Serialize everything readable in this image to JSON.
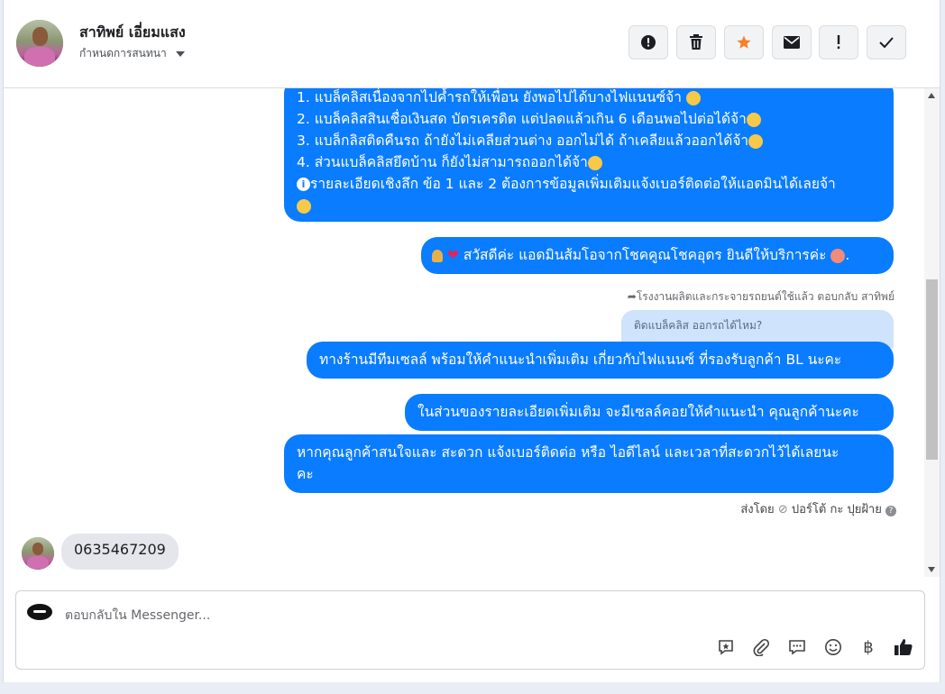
{
  "header": {
    "contact_name": "สาทิพย์ เอี่ยมแสง",
    "assign_label": "กำหนดการสนทนา",
    "buttons": [
      {
        "name": "spam-button",
        "icon": "alert-circle-icon"
      },
      {
        "name": "delete-button",
        "icon": "trash-icon"
      },
      {
        "name": "star-button",
        "icon": "star-icon"
      },
      {
        "name": "mark-unread-button",
        "icon": "envelope-icon"
      },
      {
        "name": "follow-up-button",
        "icon": "exclamation-icon"
      },
      {
        "name": "done-button",
        "icon": "check-icon"
      }
    ]
  },
  "messages": {
    "list_msg": {
      "line1": "1. แบล็คลิสเนื่องจากไปค้ำรถให้เพื่อน ยังพอไปได้บางไฟแนนซ์จ้า",
      "line2": "2. แบล็คลิสสินเชื่อเงินสด บัตรเครดิต แต่ปลดแล้วเกิน 6 เดือนพอไปต่อได้จ้า",
      "line3": "3. แบล็กลิสติดคืนรถ ถ้ายังไม่เคลียส่วนต่าง ออกไม่ได้ ถ้าเคลียแล้วออกได้จ้า",
      "line4": "4. ส่วนแบล็คลิสยึดบ้าน ก็ยังไม่สามารถออกได้จ้า",
      "line5": "รายละเอียดเชิงลึก ข้อ 1 และ 2 ต้องการข้อมูลเพิ่มเติมแจ้งเบอร์ติดต่อให้แอดมินได้เลยจ้า"
    },
    "greeting": "สวัสดีค่ะ แอดมินส้มโอจากโชคคูณโชคอุดร ยินดีให้บริการค่ะ",
    "greeting_suffix": ".",
    "reply_note": "โรงงานผลิตและกระจายรถยนต์ใช้แล้ว ตอบกลับ สาทิพย์",
    "quoted_text": "ติดแบล็คลิส ออกรถได้ไหม?",
    "msg_team": "ทางร้านมีทีมเซลล์ พร้อมให้คำแนะนำเพิ่มเติม เกี่ยวกับไฟแนนซ์ ที่รองรับลูกค้า BL นะคะ",
    "msg_details": "ในส่วนของรายละเอียดเพิ่มเติม จะมีเซลล์คอยให้คำแนะนำ คุณลูกค้านะคะ",
    "msg_contact_line1": "หากคุณลูกค้าสนใจและ สะดวก แจ้งเบอร์ติดต่อ หรือ ไอดีไลน์ และเวลาที่สะดวกไว้ได้เลยนะ",
    "msg_contact_line2": "คะ",
    "sent_by_prefix": "ส่งโดย",
    "sent_by_name": "ปอร์โต้ กะ ปุยฝ้าย",
    "incoming_phone": "0635467209"
  },
  "composer": {
    "placeholder": "ตอบกลับใน Messenger...",
    "tools": [
      "saved-reply-icon",
      "attachment-icon",
      "chat-bubble-icon",
      "emoji-icon",
      "baht-icon",
      "like-icon"
    ],
    "baht_symbol": "฿"
  },
  "colors": {
    "outgoing_bubble": "#0a7cff",
    "incoming_bubble": "#e4e6eb",
    "quoted_bubble": "#cfe3fd",
    "star": "#f5822a"
  }
}
